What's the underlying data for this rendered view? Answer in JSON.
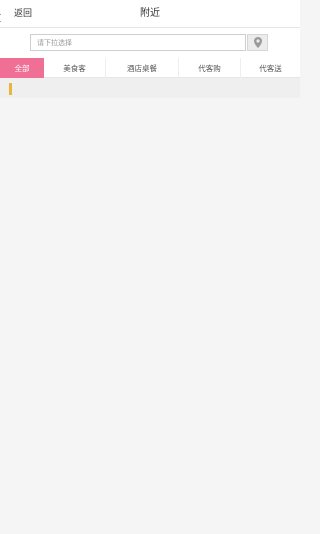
{
  "header": {
    "back_label": "返回",
    "title": "附近"
  },
  "search": {
    "placeholder": "请下拉选择",
    "value": ""
  },
  "tabs": [
    {
      "label": "全部",
      "active": true
    },
    {
      "label": "美食客",
      "active": false
    },
    {
      "label": "酒店桌餐",
      "active": false
    },
    {
      "label": "代客购",
      "active": false
    },
    {
      "label": "代客送",
      "active": false
    }
  ],
  "colors": {
    "accent": "#ef6f95",
    "marker": "#e8b63a",
    "background": "#f5f5f5"
  },
  "icons": {
    "back": "chevron-left-icon",
    "location": "map-pin-icon"
  }
}
